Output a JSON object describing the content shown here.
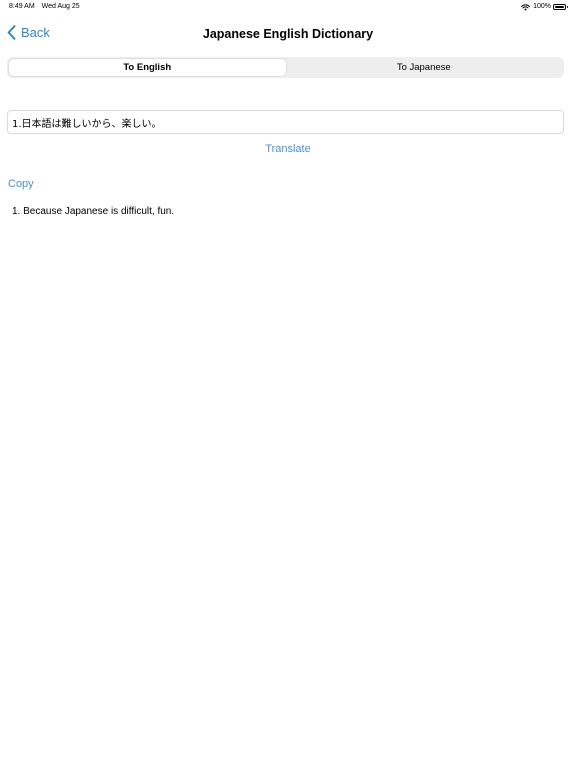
{
  "status_bar": {
    "time": "8:49 AM",
    "date": "Wed Aug 25",
    "battery": "100%",
    "icons": [
      "wifi-icon",
      "battery-icon"
    ]
  },
  "nav": {
    "back_label": "Back",
    "back_icon": "chevron-left-icon",
    "title": "Japanese English Dictionary"
  },
  "segments": {
    "items": [
      "To English",
      "To Japanese"
    ],
    "selected": "To English"
  },
  "input": {
    "value": "1.日本語は難しいから、楽しい。"
  },
  "actions": {
    "translate_label": "Translate",
    "copy_label": "Copy"
  },
  "result": {
    "text": "1. Because Japanese is difficult, fun."
  },
  "colors": {
    "accent": "#4a90d6",
    "back_accent": "#2f86d4",
    "segment_bg": "#eeeeef",
    "field_border": "#d9d9dd"
  }
}
